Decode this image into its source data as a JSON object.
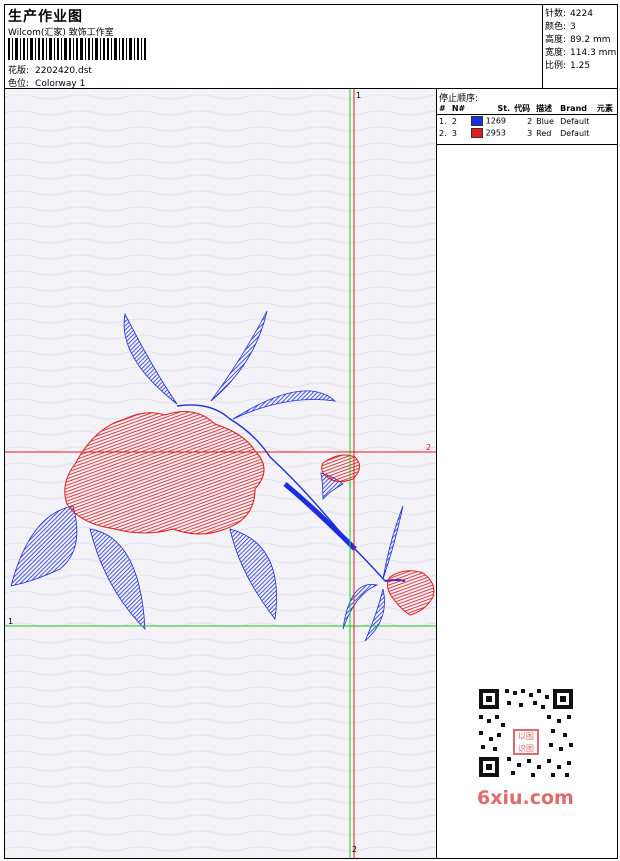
{
  "header": {
    "title": "生产作业图",
    "company": "Wilcom(汇家) 致饰工作室",
    "design_label": "花版:",
    "design_value": "2202420.dst",
    "colorway_label": "色位:",
    "colorway_value": "Colorway 1"
  },
  "stats": [
    {
      "label": "针数:",
      "value": "4224"
    },
    {
      "label": "颜色:",
      "value": "3"
    },
    {
      "label": "高度:",
      "value": "89.2 mm"
    },
    {
      "label": "宽度:",
      "value": "114.3 mm"
    },
    {
      "label": "比例:",
      "value": "1.25"
    }
  ],
  "stop_sequence": {
    "title": "停止顺序:",
    "columns": [
      "#",
      "N#",
      "St.",
      "代码",
      "描述",
      "Brand",
      "元素"
    ],
    "rows": [
      {
        "index": "1.",
        "n": "2",
        "color": "#1c2ee0",
        "stitches": "1269",
        "code": "2",
        "desc": "Blue",
        "brand": "Default",
        "element": ""
      },
      {
        "index": "2.",
        "n": "3",
        "color": "#e01c1c",
        "stitches": "2953",
        "code": "3",
        "desc": "Red",
        "brand": "Default",
        "element": ""
      }
    ]
  },
  "guides": {
    "top_label": "1",
    "bottom_label": "2",
    "right_label": "2",
    "left_label": "1"
  },
  "watermark": {
    "seal_text": "以图识图",
    "logo_text": "6xiu.com"
  },
  "colors": {
    "thread_blue": "#1c2ee0",
    "thread_red": "#e01c1c",
    "guide_green": "#22c422",
    "guide_red": "#e01c1c"
  }
}
